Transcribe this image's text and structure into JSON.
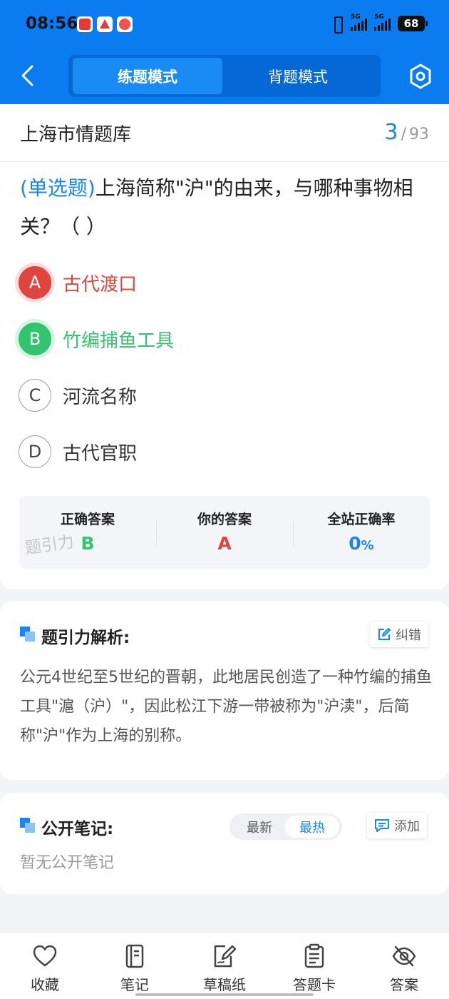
{
  "status_bar": {
    "time": "08:56",
    "network1": "5G",
    "network2": "5G",
    "battery": "68"
  },
  "header": {
    "tabs": [
      {
        "label": "练题模式",
        "active": true
      },
      {
        "label": "背题模式",
        "active": false
      }
    ]
  },
  "question_bank": {
    "title": "上海市情题库",
    "current": "3",
    "total": "93",
    "separator": "/"
  },
  "question": {
    "type_label": "(单选题)",
    "text": "上海简称\"沪\"的由来，与哪种事物相关？（      ）",
    "options": [
      {
        "letter": "A",
        "text": "古代渡口",
        "state": "wrong"
      },
      {
        "letter": "B",
        "text": "竹编捕鱼工具",
        "state": "correct"
      },
      {
        "letter": "C",
        "text": "河流名称",
        "state": "normal"
      },
      {
        "letter": "D",
        "text": "古代官职",
        "state": "normal"
      }
    ]
  },
  "answer_summary": {
    "correct_label": "正确答案",
    "correct_value": "B",
    "yours_label": "你的答案",
    "yours_value": "A",
    "rate_label": "全站正确率",
    "rate_value": "0",
    "rate_unit": "%",
    "watermark": "题引力"
  },
  "analysis": {
    "title": "题引力解析:",
    "correct_button": "纠错",
    "text": "公元4世纪至5世纪的晋朝，此地居民创造了一种竹编的捕鱼工具\"滬（沪）\"，因此松江下游一带被称为\"沪渎\"，后简称\"沪\"作为上海的别称。"
  },
  "notes": {
    "title": "公开笔记:",
    "sort_options": [
      "最新",
      "最热"
    ],
    "active_sort": "最热",
    "add_button": "添加",
    "empty_text": "暂无公开笔记"
  },
  "bottom_bar": {
    "items": [
      {
        "label": "收藏",
        "icon": "heart-icon"
      },
      {
        "label": "笔记",
        "icon": "notebook-icon"
      },
      {
        "label": "草稿纸",
        "icon": "draft-icon"
      },
      {
        "label": "答题卡",
        "icon": "clipboard-icon"
      },
      {
        "label": "答案",
        "icon": "eye-off-icon"
      }
    ]
  },
  "colors": {
    "primary": "#0a7cf0",
    "accent_blue": "#1a86ee",
    "wrong_red": "#e0443e",
    "correct_green": "#33c46f"
  }
}
